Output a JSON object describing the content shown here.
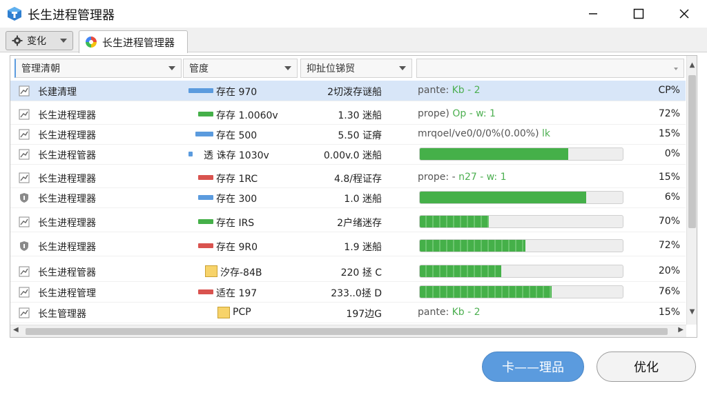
{
  "window": {
    "title": "长生进程管理器"
  },
  "tabs": {
    "dropdown_label": "变化",
    "active_label": "长生进程管理器"
  },
  "columns": [
    "管理清朝",
    "管度",
    "抑扯位锑贸",
    ""
  ],
  "rows": [
    {
      "name": "长建清理",
      "status": "存在 970",
      "desc": "2切泼存谜船",
      "info": {
        "pre": "pante:",
        "mid": "Kb",
        "post": "- 2"
      },
      "percent": "CP%",
      "selected": true,
      "icon": "chart-icon"
    },
    {
      "name": "长生进程理器",
      "status": "存存 1.0060v",
      "desc": "1.30 迷船",
      "info": {
        "pre": "prope)",
        "mid": "Op",
        "post": "- w: 1"
      },
      "percent": "72%",
      "selected": false,
      "icon": "chart-icon"
    },
    {
      "name": "长生进程理器",
      "status": "存在 500",
      "desc": "5.50 证瘠",
      "info": {
        "pre": "mrqoel/ve0/0/0%(0.00%)",
        "mid": "lk",
        "post": ""
      },
      "percent": "15%",
      "selected": false,
      "icon": "chart-icon"
    },
    {
      "name": "长生进程管器",
      "status": "透 诛存 1030v",
      "desc": "0.00v.0 迷船",
      "progress": 0.73,
      "percent": "0%",
      "selected": false,
      "icon": "chart-icon"
    },
    {
      "name": "长生进程理器",
      "status": "存存 1RC",
      "desc": "4.8/程证存",
      "info": {
        "pre": "prope: -",
        "mid": "n27",
        "post": "- w: 1"
      },
      "percent": "15%",
      "selected": false,
      "icon": "chart-icon"
    },
    {
      "name": "长生进程理器",
      "status": "存在 300",
      "desc": "1.0 迷船",
      "progress": 0.82,
      "percent": "6%",
      "selected": false,
      "icon": "shield-icon"
    },
    {
      "name": "长生进程理器",
      "status": "存在 IRS",
      "desc": "2户绪迷存",
      "progress": 0.34,
      "dashed": true,
      "percent": "70%",
      "selected": false,
      "icon": "chart-icon"
    },
    {
      "name": "长生进程理器",
      "status": "存在 9R0",
      "desc": "1.9 迷船",
      "progress": 0.52,
      "dashed": true,
      "percent": "72%",
      "selected": false,
      "icon": "shield-icon"
    },
    {
      "name": "长生进程管器",
      "status": "汐存-84B",
      "desc": "220 拯 C",
      "progress": 0.4,
      "dashed": true,
      "percent": "20%",
      "selected": false,
      "icon": "chart-icon"
    },
    {
      "name": "长生进程管理",
      "status": "适在 197",
      "desc": "233..0拯 D",
      "progress": 0.65,
      "dashed": true,
      "percent": "76%",
      "selected": false,
      "icon": "chart-icon"
    },
    {
      "name": "长生管理器",
      "status": "PCP",
      "desc": "197边G",
      "info": {
        "pre": "pante:",
        "mid": "Kb",
        "post": "- 2"
      },
      "percent": "15%",
      "selected": false,
      "icon": "chart-icon"
    }
  ],
  "colors": {
    "accent": "#5b9bde",
    "progress": "#45b049",
    "selection": "#d8e6f8"
  },
  "buttons": {
    "primary_label": "卡——理品",
    "secondary_label": "优化"
  }
}
